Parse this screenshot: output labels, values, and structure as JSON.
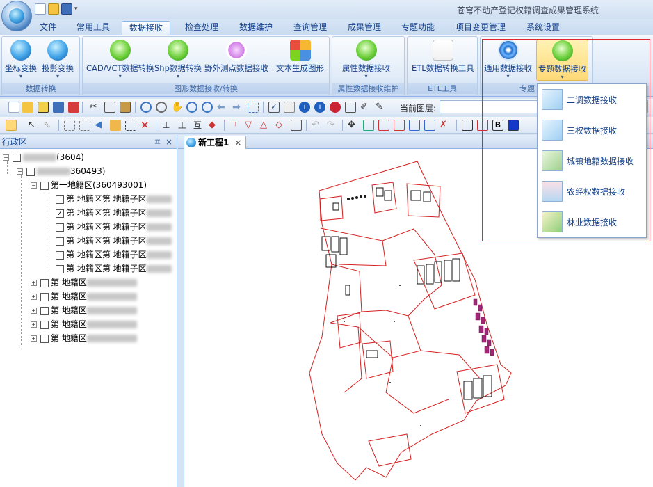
{
  "window": {
    "title": "苍穹不动产登记权籍调查成果管理系统"
  },
  "ribbon_tabs": [
    "文件",
    "常用工具",
    "数据接收",
    "检查处理",
    "数据维护",
    "查询管理",
    "成果管理",
    "专题功能",
    "项目变更管理",
    "系统设置"
  ],
  "active_tab": "数据接收",
  "groups": {
    "coord": {
      "label": "数据转换",
      "buttons": [
        "坐标变换",
        "投影变换"
      ]
    },
    "graphic": {
      "label": "图形数据接收/转换",
      "buttons": [
        "CAD/VCT数据转换",
        "Shp数据转换",
        "野外测点数据接收",
        "文本生成图形"
      ]
    },
    "attr": {
      "label": "属性数据接收维护",
      "buttons": [
        "属性数据接收"
      ]
    },
    "etl": {
      "label": "ETL工具",
      "buttons": [
        "ETL数据转换工具"
      ]
    },
    "topic": {
      "label": "专题",
      "buttons": [
        "通用数据接收",
        "专题数据接收"
      ]
    }
  },
  "toolbar": {
    "layer_label": "当前图层:",
    "layer_value": ""
  },
  "left_panel": {
    "title": "行政区",
    "pin": "ㅍ",
    "close": "×",
    "tree": [
      {
        "text": "(3604)",
        "level": 0,
        "expander": "−",
        "checked": false
      },
      {
        "text": "360493)",
        "level": 1,
        "expander": "−",
        "checked": false
      },
      {
        "text": "第一地籍区(360493001)",
        "level": 2,
        "expander": "−",
        "checked": false
      },
      {
        "text": "第 地籍区第 地籍子区",
        "level": 3,
        "expander": "",
        "checked": false
      },
      {
        "text": "第 地籍区第 地籍子区",
        "level": 3,
        "expander": "",
        "checked": true
      },
      {
        "text": "第 地籍区第 地籍子区",
        "level": 3,
        "expander": "",
        "checked": false
      },
      {
        "text": "第 地籍区第 地籍子区",
        "level": 3,
        "expander": "",
        "checked": false
      },
      {
        "text": "第 地籍区第 地籍子区",
        "level": 3,
        "expander": "",
        "checked": false
      },
      {
        "text": "第 地籍区第 地籍子区",
        "level": 3,
        "expander": "",
        "checked": false
      },
      {
        "text": "第 地籍区",
        "level": 2,
        "expander": "+",
        "checked": false
      },
      {
        "text": "第 地籍区",
        "level": 2,
        "expander": "+",
        "checked": false
      },
      {
        "text": "第 地籍区",
        "level": 2,
        "expander": "+",
        "checked": false
      },
      {
        "text": "第 地籍区",
        "level": 2,
        "expander": "+",
        "checked": false
      },
      {
        "text": "第 地籍区",
        "level": 2,
        "expander": "+",
        "checked": false
      }
    ]
  },
  "document_tab": {
    "label": "新工程1",
    "close": "×"
  },
  "dropdown_menu": {
    "items": [
      "二调数据接收",
      "三权数据接收",
      "城镇地籍数据接收",
      "农经权数据接收",
      "林业数据接收"
    ]
  }
}
